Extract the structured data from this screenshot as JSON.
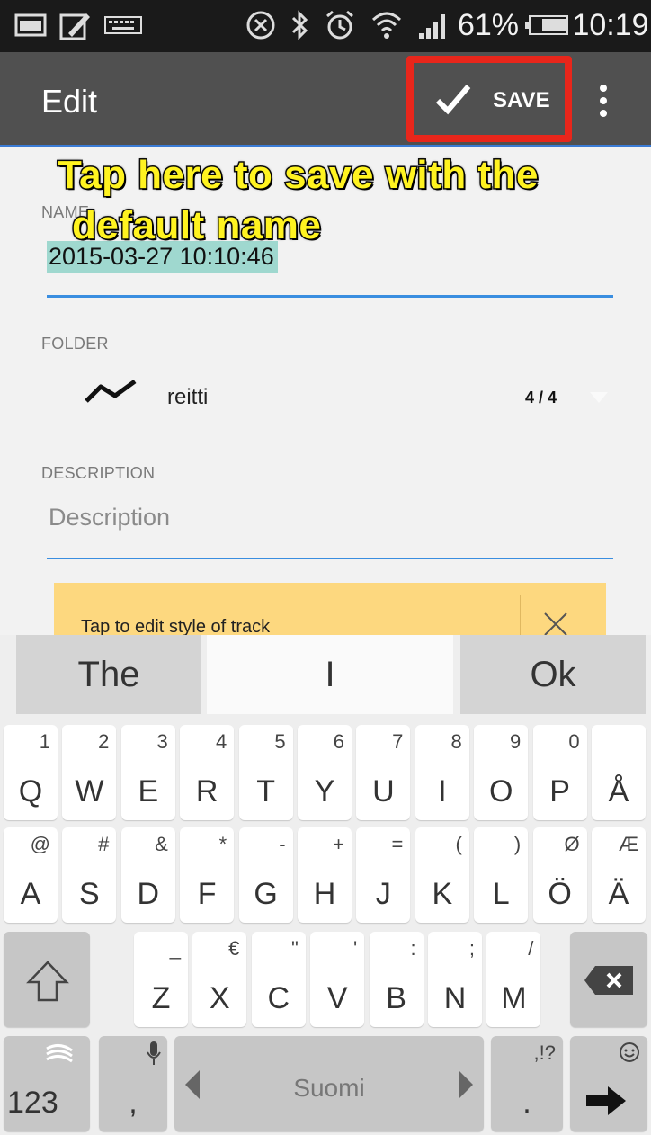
{
  "status_bar": {
    "battery_text": "61%",
    "time": "10:19"
  },
  "action_bar": {
    "title": "Edit",
    "save_label": "SAVE"
  },
  "form": {
    "name_label": "NAME",
    "name_value": "2015-03-27 10:10:46",
    "folder_label": "FOLDER",
    "folder_value": "reitti",
    "folder_count": "4 / 4",
    "description_label": "DESCRIPTION",
    "description_placeholder": "Description",
    "banner_text": "Tap to edit style of track"
  },
  "annotation": {
    "line1": "Tap here to save with the",
    "line2": "default name"
  },
  "keyboard": {
    "suggestions": [
      "The",
      "I",
      "Ok"
    ],
    "row1": [
      {
        "main": "Q",
        "sub": "1"
      },
      {
        "main": "W",
        "sub": "2"
      },
      {
        "main": "E",
        "sub": "3"
      },
      {
        "main": "R",
        "sub": "4"
      },
      {
        "main": "T",
        "sub": "5"
      },
      {
        "main": "Y",
        "sub": "6"
      },
      {
        "main": "U",
        "sub": "7"
      },
      {
        "main": "I",
        "sub": "8"
      },
      {
        "main": "O",
        "sub": "9"
      },
      {
        "main": "P",
        "sub": "0"
      },
      {
        "main": "Å",
        "sub": ""
      }
    ],
    "row2": [
      {
        "main": "A",
        "sub": "@"
      },
      {
        "main": "S",
        "sub": "#"
      },
      {
        "main": "D",
        "sub": "&"
      },
      {
        "main": "F",
        "sub": "*"
      },
      {
        "main": "G",
        "sub": "-"
      },
      {
        "main": "H",
        "sub": "+"
      },
      {
        "main": "J",
        "sub": "="
      },
      {
        "main": "K",
        "sub": "("
      },
      {
        "main": "L",
        "sub": ")"
      },
      {
        "main": "Ö",
        "sub": "Ø"
      },
      {
        "main": "Ä",
        "sub": "Æ"
      }
    ],
    "row3": [
      {
        "main": "Z",
        "sub": "_"
      },
      {
        "main": "X",
        "sub": "€"
      },
      {
        "main": "C",
        "sub": "\""
      },
      {
        "main": "V",
        "sub": "'"
      },
      {
        "main": "B",
        "sub": ":"
      },
      {
        "main": "N",
        "sub": ";"
      },
      {
        "main": "M",
        "sub": "/"
      }
    ],
    "numbers_key": "123",
    "comma_key": ",",
    "space_label": "Suomi",
    "period_key": ".",
    "period_sub": ",!?"
  }
}
